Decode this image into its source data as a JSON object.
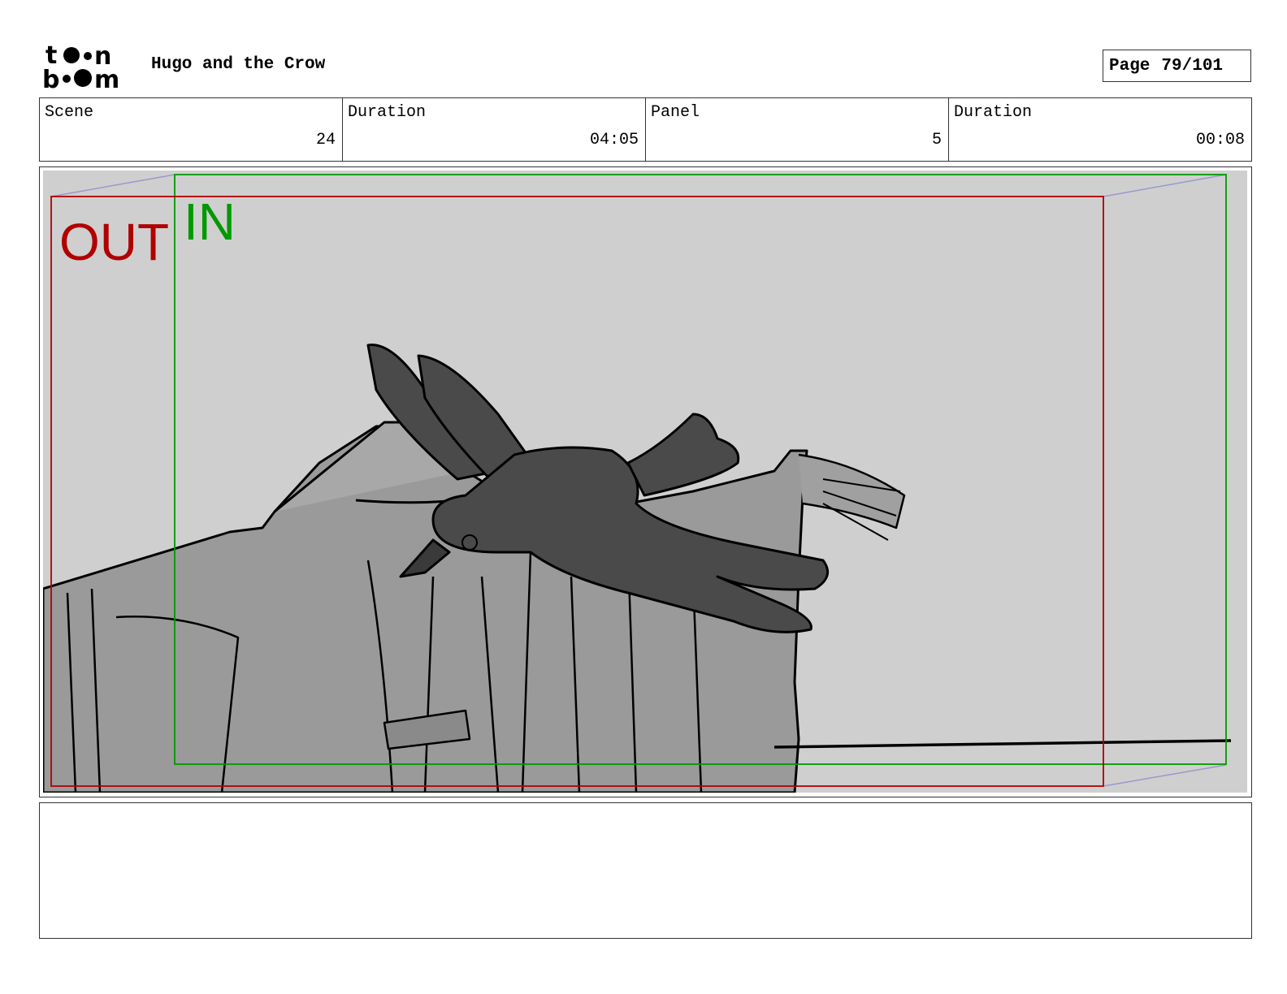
{
  "header": {
    "logo": "toon boom",
    "title": "Hugo and the Crow",
    "page_label": "Page",
    "page_number": "79/101"
  },
  "info": [
    {
      "label": "Scene",
      "value": "24"
    },
    {
      "label": "Duration",
      "value": "04:05"
    },
    {
      "label": "Panel",
      "value": "5"
    },
    {
      "label": "Duration",
      "value": "00:08"
    }
  ],
  "panel": {
    "out_label": "OUT",
    "in_label": "IN",
    "colors": {
      "out": "#b00000",
      "in": "#009900",
      "background": "#cfcfcf",
      "figure": "#9a9a9a",
      "crow": "#4a4a4a"
    }
  },
  "notes": {
    "text": ""
  }
}
